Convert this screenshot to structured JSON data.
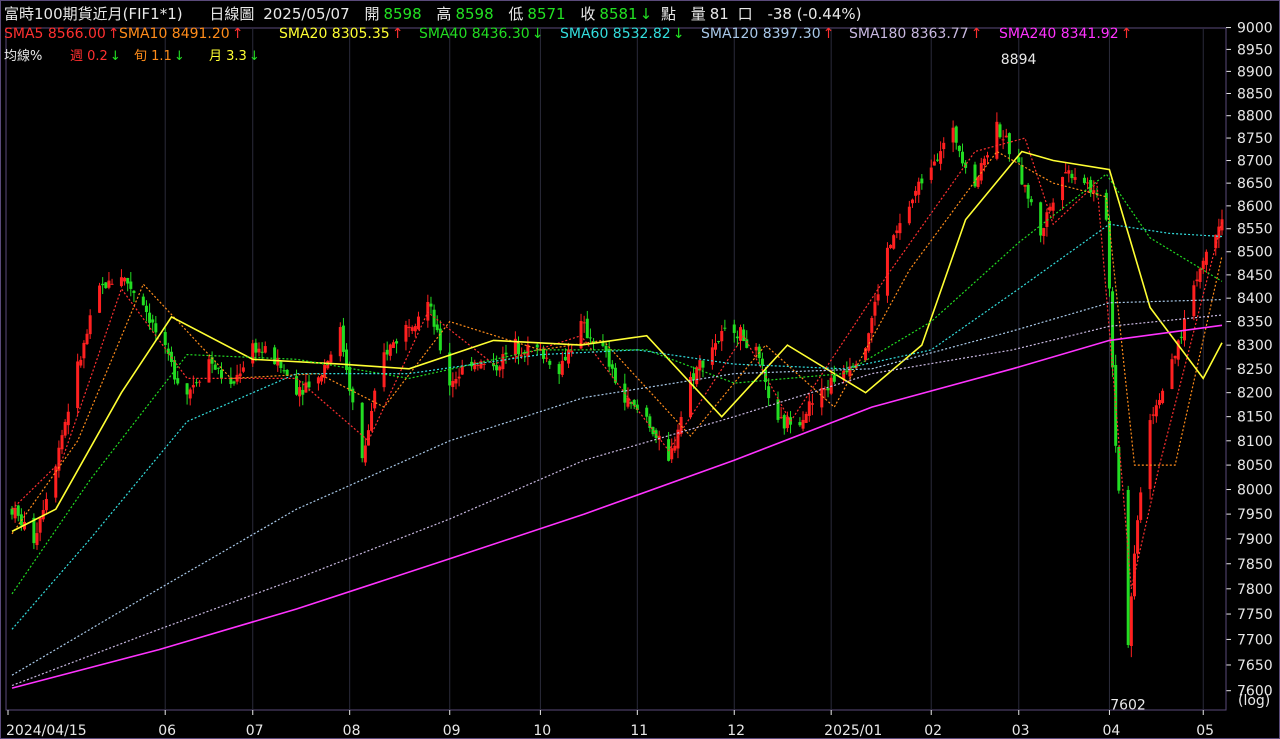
{
  "header": {
    "title": "富時100期貨近月(FIF1*1)",
    "chart_kind": "日線圖",
    "date": "2025/05/07",
    "open_label": "開",
    "open": "8598",
    "high_label": "高",
    "high": "8598",
    "low_label": "低",
    "low": "8571",
    "close_label": "收",
    "close": "8581",
    "point_label": "點",
    "volume_label": "量",
    "volume": "81",
    "volume_unit": "口",
    "change": "-38 (-0.44%)"
  },
  "sma_legend": [
    {
      "label": "SMA5",
      "value": "8566.00",
      "dir": "up",
      "color": "#ff3030"
    },
    {
      "label": "SMA10",
      "value": "8491.20",
      "dir": "up",
      "color": "#ff8c1a"
    },
    {
      "label": "SMA20",
      "value": "8305.35",
      "dir": "up",
      "color": "#ffff33"
    },
    {
      "label": "SMA40",
      "value": "8436.30",
      "dir": "down",
      "color": "#22dd22"
    },
    {
      "label": "SMA60",
      "value": "8532.82",
      "dir": "down",
      "color": "#33dddd"
    },
    {
      "label": "SMA120",
      "value": "8397.30",
      "dir": "up",
      "color": "#a8c8e8"
    },
    {
      "label": "SMA180",
      "value": "8363.77",
      "dir": "up",
      "color": "#c8b8e0"
    },
    {
      "label": "SMA240",
      "value": "8341.92",
      "dir": "up",
      "color": "#ff33ff"
    }
  ],
  "pct_legend": {
    "label": "均線%",
    "items": [
      {
        "label": "週",
        "value": "0.2",
        "dir": "down",
        "color": "#ff3030"
      },
      {
        "label": "旬",
        "value": "1.1",
        "dir": "down",
        "color": "#ff8c1a"
      },
      {
        "label": "月",
        "value": "3.3",
        "dir": "down",
        "color": "#ffff33"
      }
    ]
  },
  "colors": {
    "up": "#ff2020",
    "down": "#22dd22",
    "grid": "#2a2a3a",
    "axis": "#e8e8e8",
    "bg": "#000000"
  },
  "chart_data": {
    "type": "candlestick",
    "y_scale": "log",
    "y_scale_label": "(log)",
    "ylim": [
      7560,
      9030
    ],
    "y_ticks": [
      7600,
      7650,
      7700,
      7750,
      7800,
      7850,
      7900,
      7950,
      8000,
      8050,
      8100,
      8150,
      8200,
      8250,
      8300,
      8350,
      8400,
      8450,
      8500,
      8550,
      8600,
      8650,
      8700,
      8750,
      8800,
      8850,
      8900,
      8950,
      9000
    ],
    "x_labels": [
      {
        "label": "2024/04/15",
        "date": "2024-04-15"
      },
      {
        "label": "06",
        "date": "2024-06-03"
      },
      {
        "label": "07",
        "date": "2024-07-01"
      },
      {
        "label": "08",
        "date": "2024-08-01"
      },
      {
        "label": "09",
        "date": "2024-09-02"
      },
      {
        "label": "10",
        "date": "2024-10-01"
      },
      {
        "label": "11",
        "date": "2024-11-01"
      },
      {
        "label": "12",
        "date": "2024-12-02"
      },
      {
        "label": "2025/01",
        "date": "2025-01-02"
      },
      {
        "label": "02",
        "date": "2025-02-03"
      },
      {
        "label": "03",
        "date": "2025-03-03"
      },
      {
        "label": "04",
        "date": "2025-04-01"
      },
      {
        "label": "05",
        "date": "2025-05-01"
      }
    ],
    "x_range": [
      "2024-04-15",
      "2025-05-07"
    ],
    "annotations": [
      {
        "text": "8894",
        "date": "2025-03-03",
        "value": 8894,
        "position": "above"
      },
      {
        "text": "7602",
        "date": "2025-04-07",
        "value": 7602,
        "position": "below"
      }
    ],
    "price_anchors": [
      {
        "date": "2024-04-15",
        "value": 7960
      },
      {
        "date": "2024-04-22",
        "value": 7900
      },
      {
        "date": "2024-04-29",
        "value": 8060
      },
      {
        "date": "2024-05-06",
        "value": 8250
      },
      {
        "date": "2024-05-13",
        "value": 8420
      },
      {
        "date": "2024-05-20",
        "value": 8450
      },
      {
        "date": "2024-05-27",
        "value": 8390
      },
      {
        "date": "2024-06-03",
        "value": 8280
      },
      {
        "date": "2024-06-10",
        "value": 8200
      },
      {
        "date": "2024-06-17",
        "value": 8270
      },
      {
        "date": "2024-06-24",
        "value": 8210
      },
      {
        "date": "2024-07-01",
        "value": 8300
      },
      {
        "date": "2024-07-08",
        "value": 8270
      },
      {
        "date": "2024-07-15",
        "value": 8210
      },
      {
        "date": "2024-07-22",
        "value": 8230
      },
      {
        "date": "2024-07-29",
        "value": 8330
      },
      {
        "date": "2024-08-05",
        "value": 8060
      },
      {
        "date": "2024-08-12",
        "value": 8280
      },
      {
        "date": "2024-08-19",
        "value": 8340
      },
      {
        "date": "2024-08-26",
        "value": 8390
      },
      {
        "date": "2024-09-02",
        "value": 8220
      },
      {
        "date": "2024-09-09",
        "value": 8270
      },
      {
        "date": "2024-09-16",
        "value": 8250
      },
      {
        "date": "2024-09-23",
        "value": 8300
      },
      {
        "date": "2024-09-30",
        "value": 8290
      },
      {
        "date": "2024-10-07",
        "value": 8250
      },
      {
        "date": "2024-10-14",
        "value": 8340
      },
      {
        "date": "2024-10-21",
        "value": 8290
      },
      {
        "date": "2024-10-28",
        "value": 8180
      },
      {
        "date": "2024-11-04",
        "value": 8150
      },
      {
        "date": "2024-11-11",
        "value": 8050
      },
      {
        "date": "2024-11-18",
        "value": 8230
      },
      {
        "date": "2024-11-25",
        "value": 8300
      },
      {
        "date": "2024-12-02",
        "value": 8340
      },
      {
        "date": "2024-12-09",
        "value": 8280
      },
      {
        "date": "2024-12-16",
        "value": 8130
      },
      {
        "date": "2024-12-23",
        "value": 8150
      },
      {
        "date": "2024-12-30",
        "value": 8200
      },
      {
        "date": "2025-01-06",
        "value": 8250
      },
      {
        "date": "2025-01-13",
        "value": 8300
      },
      {
        "date": "2025-01-20",
        "value": 8500
      },
      {
        "date": "2025-01-27",
        "value": 8600
      },
      {
        "date": "2025-02-03",
        "value": 8700
      },
      {
        "date": "2025-02-10",
        "value": 8760
      },
      {
        "date": "2025-02-17",
        "value": 8650
      },
      {
        "date": "2025-02-24",
        "value": 8780
      },
      {
        "date": "2025-03-03",
        "value": 8680
      },
      {
        "date": "2025-03-10",
        "value": 8540
      },
      {
        "date": "2025-03-17",
        "value": 8680
      },
      {
        "date": "2025-03-24",
        "value": 8660
      },
      {
        "date": "2025-03-31",
        "value": 8580
      },
      {
        "date": "2025-04-03",
        "value": 8100
      },
      {
        "date": "2025-04-07",
        "value": 7700
      },
      {
        "date": "2025-04-10",
        "value": 7950
      },
      {
        "date": "2025-04-14",
        "value": 8150
      },
      {
        "date": "2025-04-21",
        "value": 8250
      },
      {
        "date": "2025-04-28",
        "value": 8430
      },
      {
        "date": "2025-05-07",
        "value": 8581
      }
    ],
    "series": [
      {
        "name": "SMA5",
        "color": "#ff3030",
        "dash": "2,2",
        "points": [
          {
            "date": "2024-04-15",
            "value": 7960
          },
          {
            "date": "2024-05-01",
            "value": 8060
          },
          {
            "date": "2024-05-20",
            "value": 8420
          },
          {
            "date": "2024-06-10",
            "value": 8230
          },
          {
            "date": "2024-07-15",
            "value": 8230
          },
          {
            "date": "2024-08-07",
            "value": 8100
          },
          {
            "date": "2024-08-26",
            "value": 8370
          },
          {
            "date": "2024-09-16",
            "value": 8260
          },
          {
            "date": "2024-10-14",
            "value": 8320
          },
          {
            "date": "2024-11-11",
            "value": 8080
          },
          {
            "date": "2024-12-05",
            "value": 8320
          },
          {
            "date": "2024-12-20",
            "value": 8140
          },
          {
            "date": "2025-01-20",
            "value": 8450
          },
          {
            "date": "2025-02-17",
            "value": 8720
          },
          {
            "date": "2025-03-05",
            "value": 8750
          },
          {
            "date": "2025-03-14",
            "value": 8560
          },
          {
            "date": "2025-03-28",
            "value": 8650
          },
          {
            "date": "2025-04-08",
            "value": 7800
          },
          {
            "date": "2025-04-17",
            "value": 8050
          },
          {
            "date": "2025-05-07",
            "value": 8566
          }
        ]
      },
      {
        "name": "SMA10",
        "color": "#ff8c1a",
        "dash": "2,2",
        "points": [
          {
            "date": "2024-04-15",
            "value": 7910
          },
          {
            "date": "2024-05-06",
            "value": 8100
          },
          {
            "date": "2024-05-27",
            "value": 8430
          },
          {
            "date": "2024-06-24",
            "value": 8230
          },
          {
            "date": "2024-07-22",
            "value": 8240
          },
          {
            "date": "2024-08-12",
            "value": 8170
          },
          {
            "date": "2024-09-02",
            "value": 8350
          },
          {
            "date": "2024-10-01",
            "value": 8290
          },
          {
            "date": "2024-10-21",
            "value": 8310
          },
          {
            "date": "2024-11-18",
            "value": 8110
          },
          {
            "date": "2024-12-12",
            "value": 8300
          },
          {
            "date": "2025-01-03",
            "value": 8170
          },
          {
            "date": "2025-01-27",
            "value": 8460
          },
          {
            "date": "2025-02-24",
            "value": 8720
          },
          {
            "date": "2025-03-14",
            "value": 8650
          },
          {
            "date": "2025-03-31",
            "value": 8620
          },
          {
            "date": "2025-04-09",
            "value": 8050
          },
          {
            "date": "2025-04-22",
            "value": 8050
          },
          {
            "date": "2025-05-07",
            "value": 8491
          }
        ]
      },
      {
        "name": "SMA20",
        "color": "#ffff33",
        "dash": "",
        "points": [
          {
            "date": "2024-04-15",
            "value": 7915
          },
          {
            "date": "2024-04-29",
            "value": 7960
          },
          {
            "date": "2024-05-20",
            "value": 8200
          },
          {
            "date": "2024-06-05",
            "value": 8360
          },
          {
            "date": "2024-07-01",
            "value": 8270
          },
          {
            "date": "2024-07-29",
            "value": 8260
          },
          {
            "date": "2024-08-20",
            "value": 8250
          },
          {
            "date": "2024-09-16",
            "value": 8310
          },
          {
            "date": "2024-10-14",
            "value": 8300
          },
          {
            "date": "2024-11-04",
            "value": 8320
          },
          {
            "date": "2024-11-28",
            "value": 8150
          },
          {
            "date": "2024-12-19",
            "value": 8300
          },
          {
            "date": "2025-01-13",
            "value": 8200
          },
          {
            "date": "2025-01-31",
            "value": 8300
          },
          {
            "date": "2025-02-14",
            "value": 8570
          },
          {
            "date": "2025-03-04",
            "value": 8720
          },
          {
            "date": "2025-03-14",
            "value": 8700
          },
          {
            "date": "2025-04-01",
            "value": 8680
          },
          {
            "date": "2025-04-14",
            "value": 8380
          },
          {
            "date": "2025-05-01",
            "value": 8230
          },
          {
            "date": "2025-05-07",
            "value": 8305
          }
        ]
      },
      {
        "name": "SMA40",
        "color": "#22dd22",
        "dash": "2,2",
        "points": [
          {
            "date": "2024-04-15",
            "value": 7790
          },
          {
            "date": "2024-05-10",
            "value": 8020
          },
          {
            "date": "2024-06-10",
            "value": 8280
          },
          {
            "date": "2024-07-15",
            "value": 8270
          },
          {
            "date": "2024-08-20",
            "value": 8230
          },
          {
            "date": "2024-09-30",
            "value": 8290
          },
          {
            "date": "2024-11-04",
            "value": 8290
          },
          {
            "date": "2024-12-02",
            "value": 8220
          },
          {
            "date": "2025-01-06",
            "value": 8240
          },
          {
            "date": "2025-02-03",
            "value": 8350
          },
          {
            "date": "2025-03-03",
            "value": 8520
          },
          {
            "date": "2025-03-31",
            "value": 8670
          },
          {
            "date": "2025-04-14",
            "value": 8530
          },
          {
            "date": "2025-05-07",
            "value": 8436
          }
        ]
      },
      {
        "name": "SMA60",
        "color": "#33dddd",
        "dash": "2,2",
        "points": [
          {
            "date": "2024-04-15",
            "value": 7720
          },
          {
            "date": "2024-05-10",
            "value": 7900
          },
          {
            "date": "2024-06-10",
            "value": 8140
          },
          {
            "date": "2024-07-15",
            "value": 8240
          },
          {
            "date": "2024-08-20",
            "value": 8240
          },
          {
            "date": "2024-10-01",
            "value": 8280
          },
          {
            "date": "2024-11-01",
            "value": 8290
          },
          {
            "date": "2024-12-02",
            "value": 8260
          },
          {
            "date": "2025-01-06",
            "value": 8250
          },
          {
            "date": "2025-02-03",
            "value": 8290
          },
          {
            "date": "2025-03-03",
            "value": 8420
          },
          {
            "date": "2025-04-01",
            "value": 8560
          },
          {
            "date": "2025-04-20",
            "value": 8540
          },
          {
            "date": "2025-05-07",
            "value": 8533
          }
        ]
      },
      {
        "name": "SMA120",
        "color": "#a8c8e8",
        "dash": "2,2",
        "points": [
          {
            "date": "2024-04-15",
            "value": 7630
          },
          {
            "date": "2024-06-01",
            "value": 7800
          },
          {
            "date": "2024-07-15",
            "value": 7960
          },
          {
            "date": "2024-09-02",
            "value": 8100
          },
          {
            "date": "2024-10-15",
            "value": 8190
          },
          {
            "date": "2024-12-02",
            "value": 8240
          },
          {
            "date": "2025-01-15",
            "value": 8250
          },
          {
            "date": "2025-03-01",
            "value": 8330
          },
          {
            "date": "2025-04-01",
            "value": 8390
          },
          {
            "date": "2025-05-07",
            "value": 8397
          }
        ]
      },
      {
        "name": "SMA180",
        "color": "#c8b8e0",
        "dash": "2,2",
        "points": [
          {
            "date": "2024-04-15",
            "value": 7610
          },
          {
            "date": "2024-06-01",
            "value": 7720
          },
          {
            "date": "2024-07-15",
            "value": 7820
          },
          {
            "date": "2024-09-02",
            "value": 7940
          },
          {
            "date": "2024-10-15",
            "value": 8060
          },
          {
            "date": "2024-12-02",
            "value": 8150
          },
          {
            "date": "2025-01-15",
            "value": 8240
          },
          {
            "date": "2025-03-01",
            "value": 8290
          },
          {
            "date": "2025-04-01",
            "value": 8340
          },
          {
            "date": "2025-05-07",
            "value": 8364
          }
        ]
      },
      {
        "name": "SMA240",
        "color": "#ff33ff",
        "dash": "",
        "points": [
          {
            "date": "2024-04-15",
            "value": 7605
          },
          {
            "date": "2024-06-01",
            "value": 7680
          },
          {
            "date": "2024-07-15",
            "value": 7760
          },
          {
            "date": "2024-09-02",
            "value": 7860
          },
          {
            "date": "2024-10-15",
            "value": 7950
          },
          {
            "date": "2024-12-02",
            "value": 8060
          },
          {
            "date": "2025-01-15",
            "value": 8170
          },
          {
            "date": "2025-03-01",
            "value": 8250
          },
          {
            "date": "2025-04-01",
            "value": 8310
          },
          {
            "date": "2025-05-07",
            "value": 8342
          }
        ]
      }
    ]
  }
}
